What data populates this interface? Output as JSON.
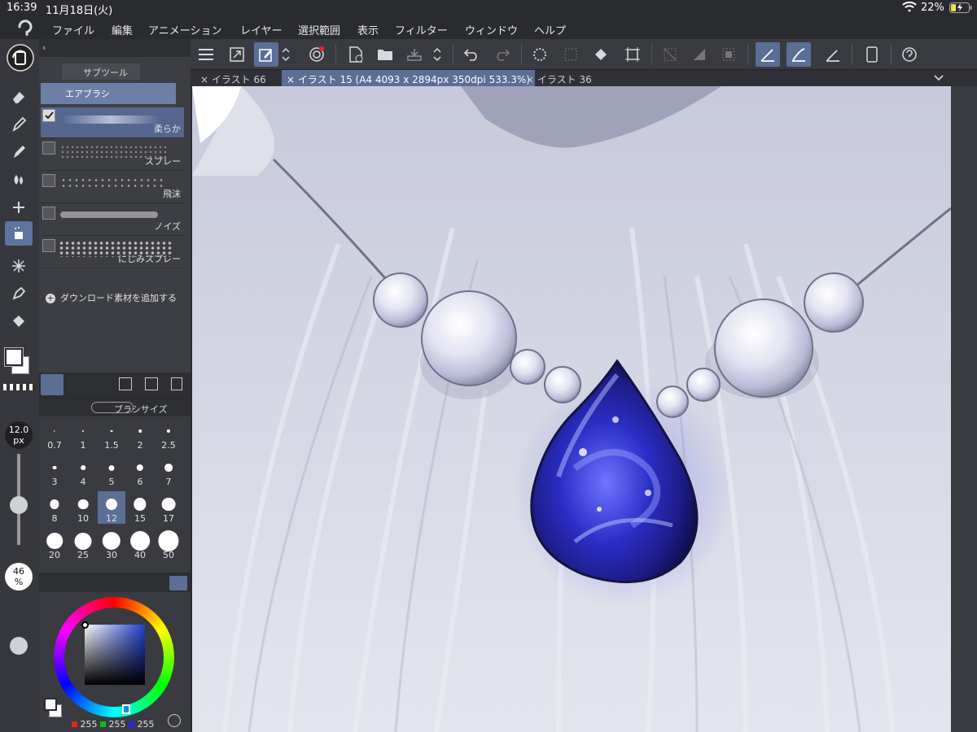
{
  "status": {
    "time": "16:39",
    "date": "11月18日(火)",
    "battery": "22%"
  },
  "menu": [
    "ファイル",
    "編集",
    "アニメーション",
    "レイヤー",
    "選択範囲",
    "表示",
    "フィルター",
    "ウィンドウ",
    "ヘルプ"
  ],
  "subtool": {
    "header": "サブツール",
    "group": "エアブラシ",
    "items": [
      {
        "name": "柔らか",
        "selected": true
      },
      {
        "name": "スプレー",
        "selected": false
      },
      {
        "name": "飛沫",
        "selected": false
      },
      {
        "name": "ノイズ",
        "selected": false
      },
      {
        "name": "にじみスプレー",
        "selected": false
      }
    ],
    "add_material": "ダウンロード素材を追加する"
  },
  "brush": {
    "header": "ブラシサイズ",
    "current_size": "12.0",
    "size_unit": "px",
    "opacity": "46",
    "opacity_unit": "%",
    "sizes": [
      "0.7",
      "1",
      "1.5",
      "2",
      "2.5",
      "3",
      "4",
      "5",
      "6",
      "7",
      "8",
      "10",
      "12",
      "15",
      "17",
      "20",
      "25",
      "30",
      "40",
      "50"
    ],
    "selected": "12"
  },
  "color": {
    "r": "255",
    "g": "255",
    "b": "255",
    "hue_base": "#1f3fd0"
  },
  "tabs": [
    {
      "label": "イラスト 66",
      "active": false
    },
    {
      "label": "イラスト 15 (A4 4093 x 2894px 350dpi 533.3%)",
      "active": true
    },
    {
      "label": "イラスト 36",
      "active": false
    }
  ],
  "colors": {
    "accent": "#5a6e96",
    "panel": "#3a3b40",
    "gem": "#2a2fc8"
  }
}
